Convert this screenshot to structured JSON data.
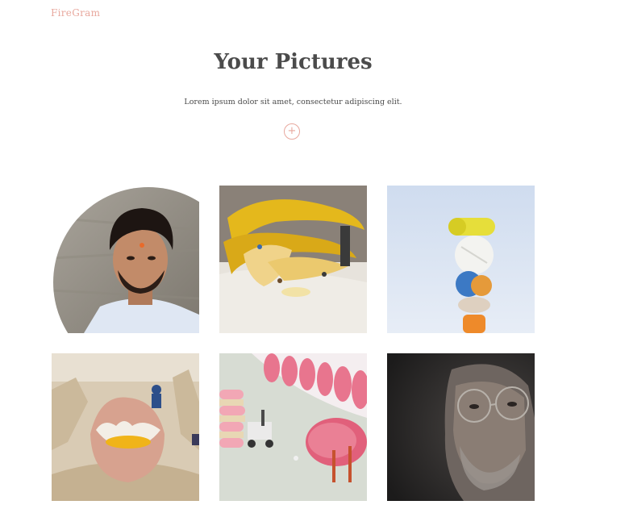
{
  "header": {
    "brand": "FireGram"
  },
  "main": {
    "title": "Your Pictures",
    "subtitle": "Lorem ipsum dolor sit amet, consectetur adipiscing elit.",
    "add_button_symbol": "+"
  },
  "gallery": [
    {
      "subject": "portrait of young man with bindi",
      "shape": "circle"
    },
    {
      "subject": "bananas with miniature figures",
      "shape": "square"
    },
    {
      "subject": "stacked pills against sky",
      "shape": "square"
    },
    {
      "subject": "cracked egg in carton with miniature workers",
      "shape": "square"
    },
    {
      "subject": "pink macarons with miniature forklift and painters",
      "shape": "square"
    },
    {
      "subject": "dark portrait of man with glasses",
      "shape": "square"
    }
  ],
  "colors": {
    "accent": "#e8a89e",
    "title": "#4b4b4b",
    "background": "#ffffff"
  }
}
